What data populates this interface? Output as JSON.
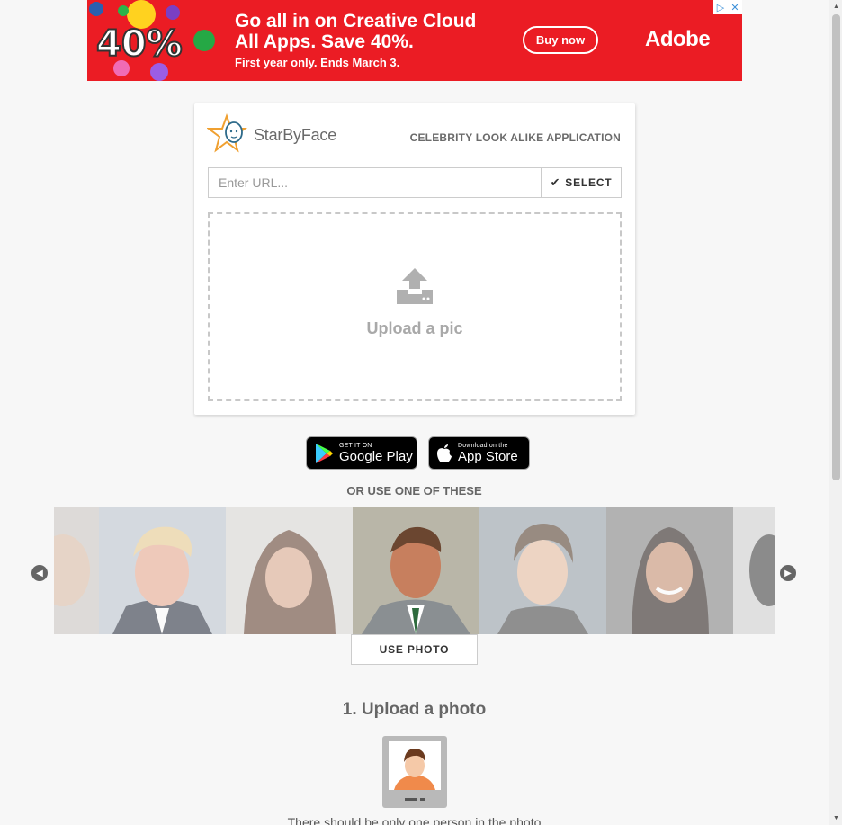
{
  "ad": {
    "art_text": "40%",
    "headline_line1": "Go all in on Creative Cloud",
    "headline_line2": "All Apps. Save 40%.",
    "subline": "First year only. Ends March 3.",
    "cta": "Buy now",
    "brand": "Adobe",
    "adchoices_icon": "adchoices-icon",
    "close_icon": "close-icon",
    "bg_color": "#eb1c24"
  },
  "header": {
    "logo_text": "StarByFace",
    "tagline": "CELEBRITY LOOK ALIKE APPLICATION"
  },
  "url_form": {
    "placeholder": "Enter URL...",
    "select_label": "SELECT"
  },
  "upload": {
    "label": "Upload a pic",
    "icon": "upload-icon"
  },
  "stores": {
    "google_small": "GET IT ON",
    "google_big": "Google Play",
    "apple_small": "Download on the",
    "apple_big": "App Store"
  },
  "carousel": {
    "heading": "OR USE ONE OF THESE",
    "use_photo_label": "USE PHOTO",
    "prev_icon": "chevron-left-icon",
    "next_icon": "chevron-right-icon"
  },
  "steps": {
    "step1_title": "1. Upload a photo",
    "step1_desc": "There should be only one person in the photo"
  }
}
